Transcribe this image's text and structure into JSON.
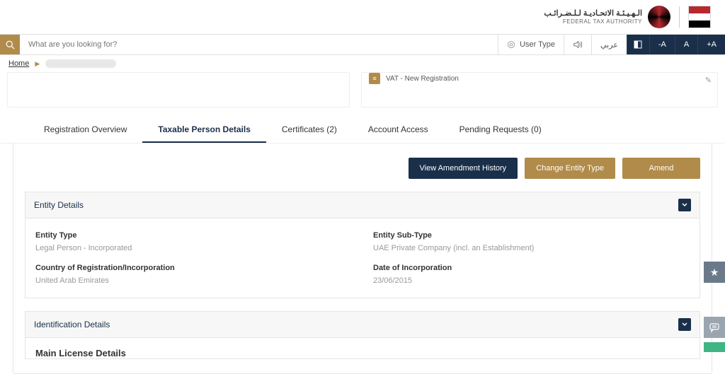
{
  "header": {
    "logo_ar": "الـهـيـئـة الاتحـاديـة لـلـضـرائـب",
    "logo_en": "FEDERAL TAX AUTHORITY"
  },
  "topbar": {
    "search_placeholder": "What are you looking for?",
    "user_type": "User Type",
    "lang": "عربي",
    "font_minus": "-A",
    "font_normal": "A",
    "font_plus": "+A"
  },
  "breadcrumb": {
    "home": "Home"
  },
  "vat_card": {
    "label": "VAT - New Registration"
  },
  "tabs": [
    {
      "label": "Registration Overview"
    },
    {
      "label": "Taxable Person Details"
    },
    {
      "label": "Certificates (2)"
    },
    {
      "label": "Account Access"
    },
    {
      "label": "Pending Requests (0)"
    }
  ],
  "buttons": {
    "view_history": "View Amendment History",
    "change_type": "Change Entity Type",
    "amend": "Amend"
  },
  "sections": {
    "entity": {
      "title": "Entity Details",
      "fields": {
        "entity_type_label": "Entity Type",
        "entity_type_value": "Legal Person - Incorporated",
        "entity_subtype_label": "Entity Sub-Type",
        "entity_subtype_value": "UAE Private Company (incl. an Establishment)",
        "country_label": "Country of Registration/Incorporation",
        "country_value": "United Arab Emirates",
        "date_label": "Date of Incorporation",
        "date_value": "23/06/2015"
      }
    },
    "identification": {
      "title": "Identification Details",
      "subheading": "Main License Details"
    }
  }
}
